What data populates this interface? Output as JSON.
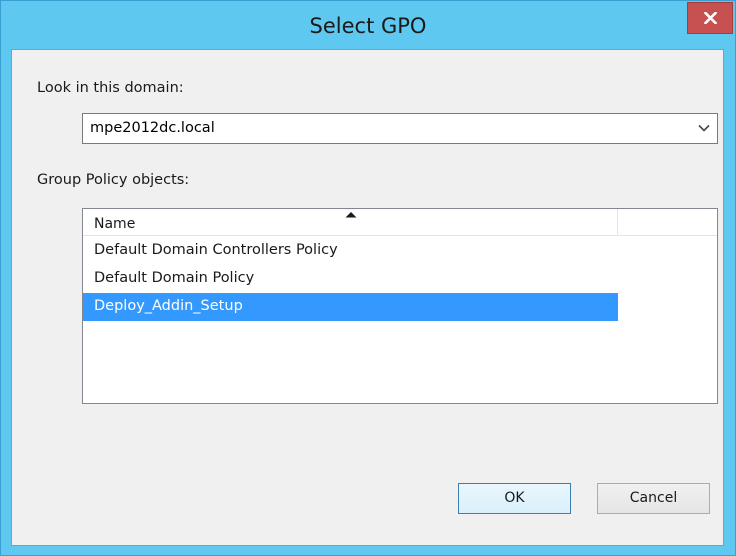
{
  "window": {
    "title": "Select GPO"
  },
  "domain": {
    "label": "Look in this domain:",
    "value": "mpe2012dc.local"
  },
  "gpo": {
    "label": "Group Policy objects:",
    "column_header": "Name",
    "items": [
      {
        "label": "Default Domain Controllers Policy",
        "selected": false
      },
      {
        "label": "Default Domain Policy",
        "selected": false
      },
      {
        "label": "Deploy_Addin_Setup",
        "selected": true
      }
    ]
  },
  "buttons": {
    "ok": "OK",
    "cancel": "Cancel"
  },
  "icons": {
    "close": "close-icon",
    "dropdown": "chevron-down-icon",
    "sort": "sort-ascending-icon"
  },
  "colors": {
    "titlebar": "#5ec8f0",
    "close_button": "#c75050",
    "selection": "#3399ff"
  }
}
